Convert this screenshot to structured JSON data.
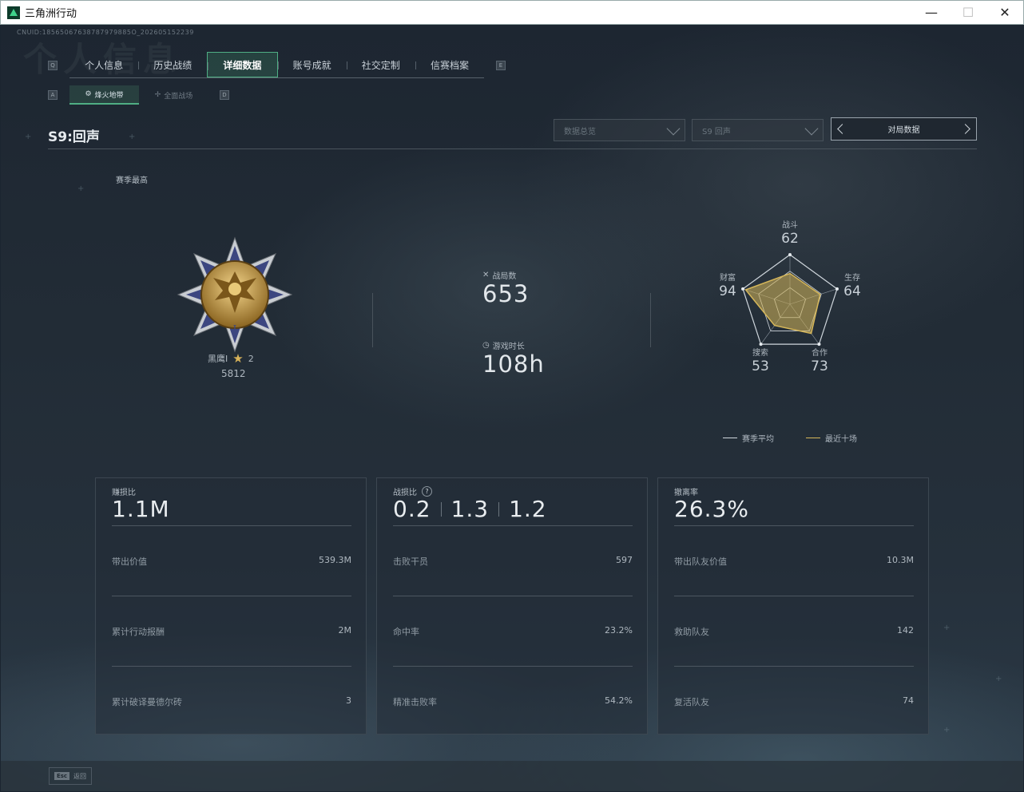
{
  "window": {
    "title": "三角洲行动",
    "minimize": "—",
    "maximize": "☐",
    "close": "✕"
  },
  "cnuid": "CNUID:18565067638787979885O_202605152239",
  "bg_title": "个人信息",
  "key_hints": {
    "tab_left": "Q",
    "tab_right": "E",
    "sub_left": "A",
    "sub_right": "D"
  },
  "tabs": [
    "个人信息",
    "历史战绩",
    "详细数据",
    "账号成就",
    "社交定制",
    "信赛档案"
  ],
  "active_tab": 2,
  "subtabs": [
    {
      "icon": "⚙",
      "label": "烽火地带"
    },
    {
      "icon": "✢",
      "label": "全面战场"
    }
  ],
  "season_title": "S9:回声",
  "dropdowns": [
    "数据总览",
    "S9 回声"
  ],
  "match_button": "对局数据",
  "season_high": "赛季最高",
  "rank": {
    "name": "黑鹰I",
    "stars": "2",
    "score": "5812"
  },
  "stats": {
    "matches_label": "战局数",
    "matches_value": "653",
    "playtime_label": "游戏时长",
    "playtime_value": "108h"
  },
  "radar": {
    "axes": [
      {
        "label": "战斗",
        "value": 62
      },
      {
        "label": "生存",
        "value": 64
      },
      {
        "label": "合作",
        "value": 73
      },
      {
        "label": "搜索",
        "value": 53
      },
      {
        "label": "财富",
        "value": 94
      }
    ],
    "colors": {
      "season_avg": "#cfd6dc",
      "recent": "#d6b75a"
    }
  },
  "legend": {
    "season_avg": "赛季平均",
    "recent": "最近十场"
  },
  "cards": [
    {
      "title": "赚损比",
      "help": "",
      "values": [
        "1.1M"
      ],
      "rows": [
        [
          "带出价值",
          "539.3M"
        ],
        [
          "累计行动报酬",
          "2M"
        ],
        [
          "累计破译曼德尔砖",
          "3"
        ]
      ]
    },
    {
      "title": "战损比",
      "help": "?",
      "values": [
        "0.2",
        "1.3",
        "1.2"
      ],
      "rows": [
        [
          "击败干员",
          "597"
        ],
        [
          "命中率",
          "23.2%"
        ],
        [
          "精准击败率",
          "54.2%"
        ]
      ]
    },
    {
      "title": "撤离率",
      "help": "",
      "values": [
        "26.3%"
      ],
      "rows": [
        [
          "带出队友价值",
          "10.3M"
        ],
        [
          "救助队友",
          "142"
        ],
        [
          "复活队友",
          "74"
        ]
      ]
    }
  ],
  "esc": {
    "key": "Esc",
    "label": "返回"
  }
}
